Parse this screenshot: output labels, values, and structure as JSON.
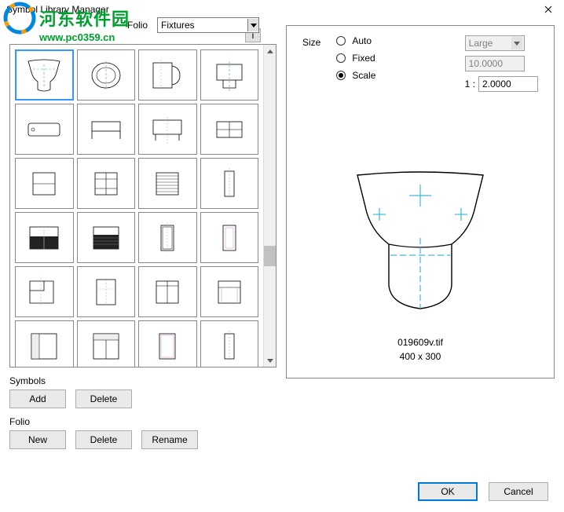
{
  "window": {
    "title": "Symbol Library Manager"
  },
  "watermark": {
    "text": "河东软件园",
    "url": "www.pc0359.cn"
  },
  "folio": {
    "label": "Folio",
    "value": "Fixtures"
  },
  "info_button": "i",
  "size": {
    "label": "Size",
    "auto_label": "Auto",
    "fixed_label": "Fixed",
    "scale_label": "Scale",
    "selected": "scale",
    "dropdown_value": "Large",
    "fixed_value": "10.0000",
    "scale_prefix": "1 :",
    "scale_value": "2.0000"
  },
  "preview": {
    "filename": "019609v.tif",
    "dimensions": "400 x 300"
  },
  "sections": {
    "symbols_label": "Symbols",
    "folio_label": "Folio"
  },
  "buttons": {
    "add": "Add",
    "delete": "Delete",
    "new": "New",
    "rename": "Rename",
    "ok": "OK",
    "cancel": "Cancel"
  }
}
